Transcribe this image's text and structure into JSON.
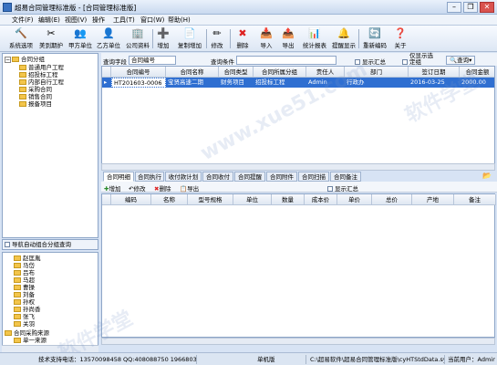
{
  "window": {
    "title": "超易合同管理标准版 - [合同管理标准版]",
    "minimize": "–",
    "restore": "❐",
    "close": "✕"
  },
  "menu": [
    "文件(F)",
    "编辑(E)",
    "视图(V)",
    "操作",
    "工具(T)",
    "窗口(W)",
    "帮助(H)"
  ],
  "toolbar": [
    {
      "label": "系统选项",
      "icon": "🔨"
    },
    {
      "label": "美到期护",
      "icon": "✂"
    },
    {
      "label": "甲方单位",
      "icon": "👥"
    },
    {
      "label": "乙方单位",
      "icon": "👤"
    },
    {
      "label": "公司资料",
      "icon": "🏢"
    },
    {
      "label": "增加",
      "icon": "➕"
    },
    {
      "label": "复制增加",
      "icon": "📄"
    },
    {
      "label": "修改",
      "icon": "✏"
    },
    {
      "label": "删除",
      "icon": "✖"
    },
    {
      "label": "导入",
      "icon": "📥"
    },
    {
      "label": "导出",
      "icon": "📤"
    },
    {
      "label": "统计报表",
      "icon": "📊"
    },
    {
      "label": "提醒显示",
      "icon": "🔔"
    },
    {
      "label": "重新编码",
      "icon": "🔄"
    },
    {
      "label": "关于",
      "icon": "❓"
    }
  ],
  "tree": {
    "root": "合同分组",
    "children": [
      "普通用户工程",
      "招投标工程",
      "内部自行工程",
      "采购合同",
      "销售合同",
      "报备项目"
    ]
  },
  "left_bottom_header": "导航自动组合分组查询",
  "left_list": [
    "赵匡胤",
    "马岱",
    "吕布",
    "马超",
    "曹操",
    "刘备",
    "孙权",
    "孙尚香",
    "张飞",
    "关羽",
    "合同采购来源",
    "单一来源"
  ],
  "search": {
    "field_label": "查询字段",
    "field_value": "合同编号",
    "condition_label": "查询条件",
    "show_summary": "显示汇总",
    "show_only_selected": "仅显示选定组",
    "query_button": "查询"
  },
  "grid": {
    "columns": [
      "合同编号",
      "合同名称",
      "合同类型",
      "合同所属分组",
      "责任人",
      "部门",
      "签订日期",
      "合同金额"
    ],
    "rows": [
      [
        "HT201603-0006",
        "宝贤高速二期",
        "财务项目",
        "招投标工程",
        "Admin",
        "行政办",
        "2016-03-25",
        "2000.00"
      ]
    ]
  },
  "tabs": [
    "合同明细",
    "合同执行",
    "收付款计划",
    "合同收付",
    "合同提醒",
    "合同附件",
    "合同扫描",
    "合同备注"
  ],
  "sub_toolbar": {
    "add": "增加",
    "edit": "修改",
    "delete": "删除",
    "export": "导出",
    "show_summary": "显示汇总"
  },
  "detail_columns": [
    "编码",
    "名称",
    "型号规格",
    "单位",
    "数量",
    "成本价",
    "单价",
    "总价",
    "产地",
    "备注"
  ],
  "status": {
    "support": "技术支持电话：13570098458 QQ:408088750 1966803818",
    "edition": "单机版",
    "path": "C:\\超易软件\\超易合同管理标准版\\cyHTStdData.sys",
    "user": "当前用户：Admin"
  },
  "watermark": [
    "www.xue51.com",
    "软件学堂"
  ]
}
